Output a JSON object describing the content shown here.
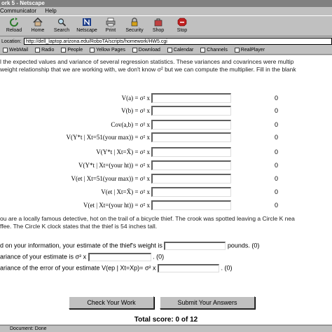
{
  "window": {
    "title": "ork 5 - Netscape"
  },
  "menu": {
    "items": [
      "Communicator",
      "Help"
    ]
  },
  "toolbar": {
    "buttons": [
      {
        "label": "Reload",
        "icon": "reload-icon"
      },
      {
        "label": "Home",
        "icon": "home-icon"
      },
      {
        "label": "Search",
        "icon": "search-icon"
      },
      {
        "label": "Netscape",
        "icon": "netscape-icon"
      },
      {
        "label": "Print",
        "icon": "print-icon"
      },
      {
        "label": "Security",
        "icon": "lock-icon"
      },
      {
        "label": "Shop",
        "icon": "shop-icon"
      },
      {
        "label": "Stop",
        "icon": "stop-icon"
      }
    ]
  },
  "location": {
    "label": "Location:",
    "url": "http://dell_laptop.arizona.edu/RoboTA/scripts/homework/HW5.cgi"
  },
  "personal_toolbar": {
    "items": [
      "WebMail",
      "Radio",
      "People",
      "Yellow Pages",
      "Download",
      "Calendar",
      "Channels",
      "RealPlayer"
    ]
  },
  "content": {
    "intro_line1": "l the expected values and variance of several regression statistics.  These variances and covarinces were multip",
    "intro_line2": "weight relationship that we are working with, we don't know σ² but we can compute the multiplier.  Fill in the blank",
    "rows": [
      {
        "lhs": "V(a) =",
        "rhs": "σ² x",
        "score": "0"
      },
      {
        "lhs": "V(b) =",
        "rhs": "σ² x",
        "score": "0"
      },
      {
        "lhs": "Cov(a,b) =",
        "rhs": "σ² x",
        "score": "0"
      },
      {
        "lhs": "V(Y*t | Xt=51(your max)) =",
        "rhs": "σ² x",
        "score": "0"
      },
      {
        "lhs": "V(Y*t | Xt=X̄) =",
        "rhs": "σ² x",
        "score": "0"
      },
      {
        "lhs": "V(Y*t | Xt=(your ht)) =",
        "rhs": "σ² x",
        "score": "0"
      },
      {
        "lhs": "V(et | Xt=51(your max)) =",
        "rhs": "σ² x",
        "score": "0"
      },
      {
        "lhs": "V(et | Xt=X̄) =",
        "rhs": "σ² x",
        "score": "0"
      },
      {
        "lhs": "V(et | Xt=(your ht)) =",
        "rhs": "σ² x",
        "score": "0"
      }
    ],
    "story_line1": "ou are a locally famous detective, hot on the trail of a bicycle thief.   The crook was spotted leaving a Circle K nea",
    "story_line2": "ffee.  The Circle K clock states that the thief is 54 inches tall.",
    "q1_prefix": "d on your information, your estimate of the thief's weight is",
    "q1_suffix": "pounds. (0)",
    "q2_prefix": "ariance of your estimate is σ² x",
    "q2_suffix": ". (0)",
    "q3_prefix": "ariance of the error of your estimate V(ep | Xt=Xp)= σ² x",
    "q3_suffix": ". (0)",
    "check_button": "Check Your Work",
    "submit_button": "Submit Your Answers",
    "total_score": "Total score: 0 of 12"
  },
  "status": {
    "text": "Document: Done"
  }
}
